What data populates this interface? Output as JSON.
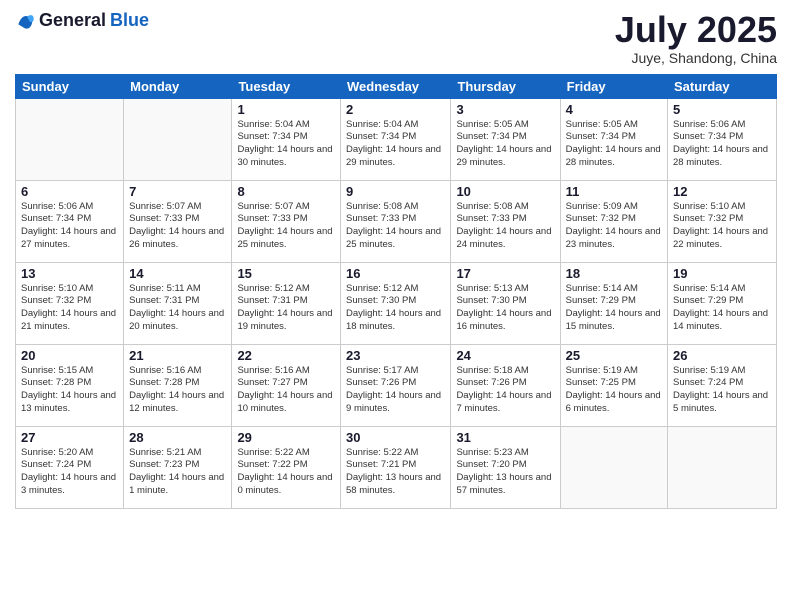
{
  "logo": {
    "general": "General",
    "blue": "Blue"
  },
  "header": {
    "month": "July 2025",
    "location": "Juye, Shandong, China"
  },
  "weekdays": [
    "Sunday",
    "Monday",
    "Tuesday",
    "Wednesday",
    "Thursday",
    "Friday",
    "Saturday"
  ],
  "weeks": [
    [
      {
        "day": "",
        "info": ""
      },
      {
        "day": "",
        "info": ""
      },
      {
        "day": "1",
        "info": "Sunrise: 5:04 AM\nSunset: 7:34 PM\nDaylight: 14 hours and 30 minutes."
      },
      {
        "day": "2",
        "info": "Sunrise: 5:04 AM\nSunset: 7:34 PM\nDaylight: 14 hours and 29 minutes."
      },
      {
        "day": "3",
        "info": "Sunrise: 5:05 AM\nSunset: 7:34 PM\nDaylight: 14 hours and 29 minutes."
      },
      {
        "day": "4",
        "info": "Sunrise: 5:05 AM\nSunset: 7:34 PM\nDaylight: 14 hours and 28 minutes."
      },
      {
        "day": "5",
        "info": "Sunrise: 5:06 AM\nSunset: 7:34 PM\nDaylight: 14 hours and 28 minutes."
      }
    ],
    [
      {
        "day": "6",
        "info": "Sunrise: 5:06 AM\nSunset: 7:34 PM\nDaylight: 14 hours and 27 minutes."
      },
      {
        "day": "7",
        "info": "Sunrise: 5:07 AM\nSunset: 7:33 PM\nDaylight: 14 hours and 26 minutes."
      },
      {
        "day": "8",
        "info": "Sunrise: 5:07 AM\nSunset: 7:33 PM\nDaylight: 14 hours and 25 minutes."
      },
      {
        "day": "9",
        "info": "Sunrise: 5:08 AM\nSunset: 7:33 PM\nDaylight: 14 hours and 25 minutes."
      },
      {
        "day": "10",
        "info": "Sunrise: 5:08 AM\nSunset: 7:33 PM\nDaylight: 14 hours and 24 minutes."
      },
      {
        "day": "11",
        "info": "Sunrise: 5:09 AM\nSunset: 7:32 PM\nDaylight: 14 hours and 23 minutes."
      },
      {
        "day": "12",
        "info": "Sunrise: 5:10 AM\nSunset: 7:32 PM\nDaylight: 14 hours and 22 minutes."
      }
    ],
    [
      {
        "day": "13",
        "info": "Sunrise: 5:10 AM\nSunset: 7:32 PM\nDaylight: 14 hours and 21 minutes."
      },
      {
        "day": "14",
        "info": "Sunrise: 5:11 AM\nSunset: 7:31 PM\nDaylight: 14 hours and 20 minutes."
      },
      {
        "day": "15",
        "info": "Sunrise: 5:12 AM\nSunset: 7:31 PM\nDaylight: 14 hours and 19 minutes."
      },
      {
        "day": "16",
        "info": "Sunrise: 5:12 AM\nSunset: 7:30 PM\nDaylight: 14 hours and 18 minutes."
      },
      {
        "day": "17",
        "info": "Sunrise: 5:13 AM\nSunset: 7:30 PM\nDaylight: 14 hours and 16 minutes."
      },
      {
        "day": "18",
        "info": "Sunrise: 5:14 AM\nSunset: 7:29 PM\nDaylight: 14 hours and 15 minutes."
      },
      {
        "day": "19",
        "info": "Sunrise: 5:14 AM\nSunset: 7:29 PM\nDaylight: 14 hours and 14 minutes."
      }
    ],
    [
      {
        "day": "20",
        "info": "Sunrise: 5:15 AM\nSunset: 7:28 PM\nDaylight: 14 hours and 13 minutes."
      },
      {
        "day": "21",
        "info": "Sunrise: 5:16 AM\nSunset: 7:28 PM\nDaylight: 14 hours and 12 minutes."
      },
      {
        "day": "22",
        "info": "Sunrise: 5:16 AM\nSunset: 7:27 PM\nDaylight: 14 hours and 10 minutes."
      },
      {
        "day": "23",
        "info": "Sunrise: 5:17 AM\nSunset: 7:26 PM\nDaylight: 14 hours and 9 minutes."
      },
      {
        "day": "24",
        "info": "Sunrise: 5:18 AM\nSunset: 7:26 PM\nDaylight: 14 hours and 7 minutes."
      },
      {
        "day": "25",
        "info": "Sunrise: 5:19 AM\nSunset: 7:25 PM\nDaylight: 14 hours and 6 minutes."
      },
      {
        "day": "26",
        "info": "Sunrise: 5:19 AM\nSunset: 7:24 PM\nDaylight: 14 hours and 5 minutes."
      }
    ],
    [
      {
        "day": "27",
        "info": "Sunrise: 5:20 AM\nSunset: 7:24 PM\nDaylight: 14 hours and 3 minutes."
      },
      {
        "day": "28",
        "info": "Sunrise: 5:21 AM\nSunset: 7:23 PM\nDaylight: 14 hours and 1 minute."
      },
      {
        "day": "29",
        "info": "Sunrise: 5:22 AM\nSunset: 7:22 PM\nDaylight: 14 hours and 0 minutes."
      },
      {
        "day": "30",
        "info": "Sunrise: 5:22 AM\nSunset: 7:21 PM\nDaylight: 13 hours and 58 minutes."
      },
      {
        "day": "31",
        "info": "Sunrise: 5:23 AM\nSunset: 7:20 PM\nDaylight: 13 hours and 57 minutes."
      },
      {
        "day": "",
        "info": ""
      },
      {
        "day": "",
        "info": ""
      }
    ]
  ]
}
